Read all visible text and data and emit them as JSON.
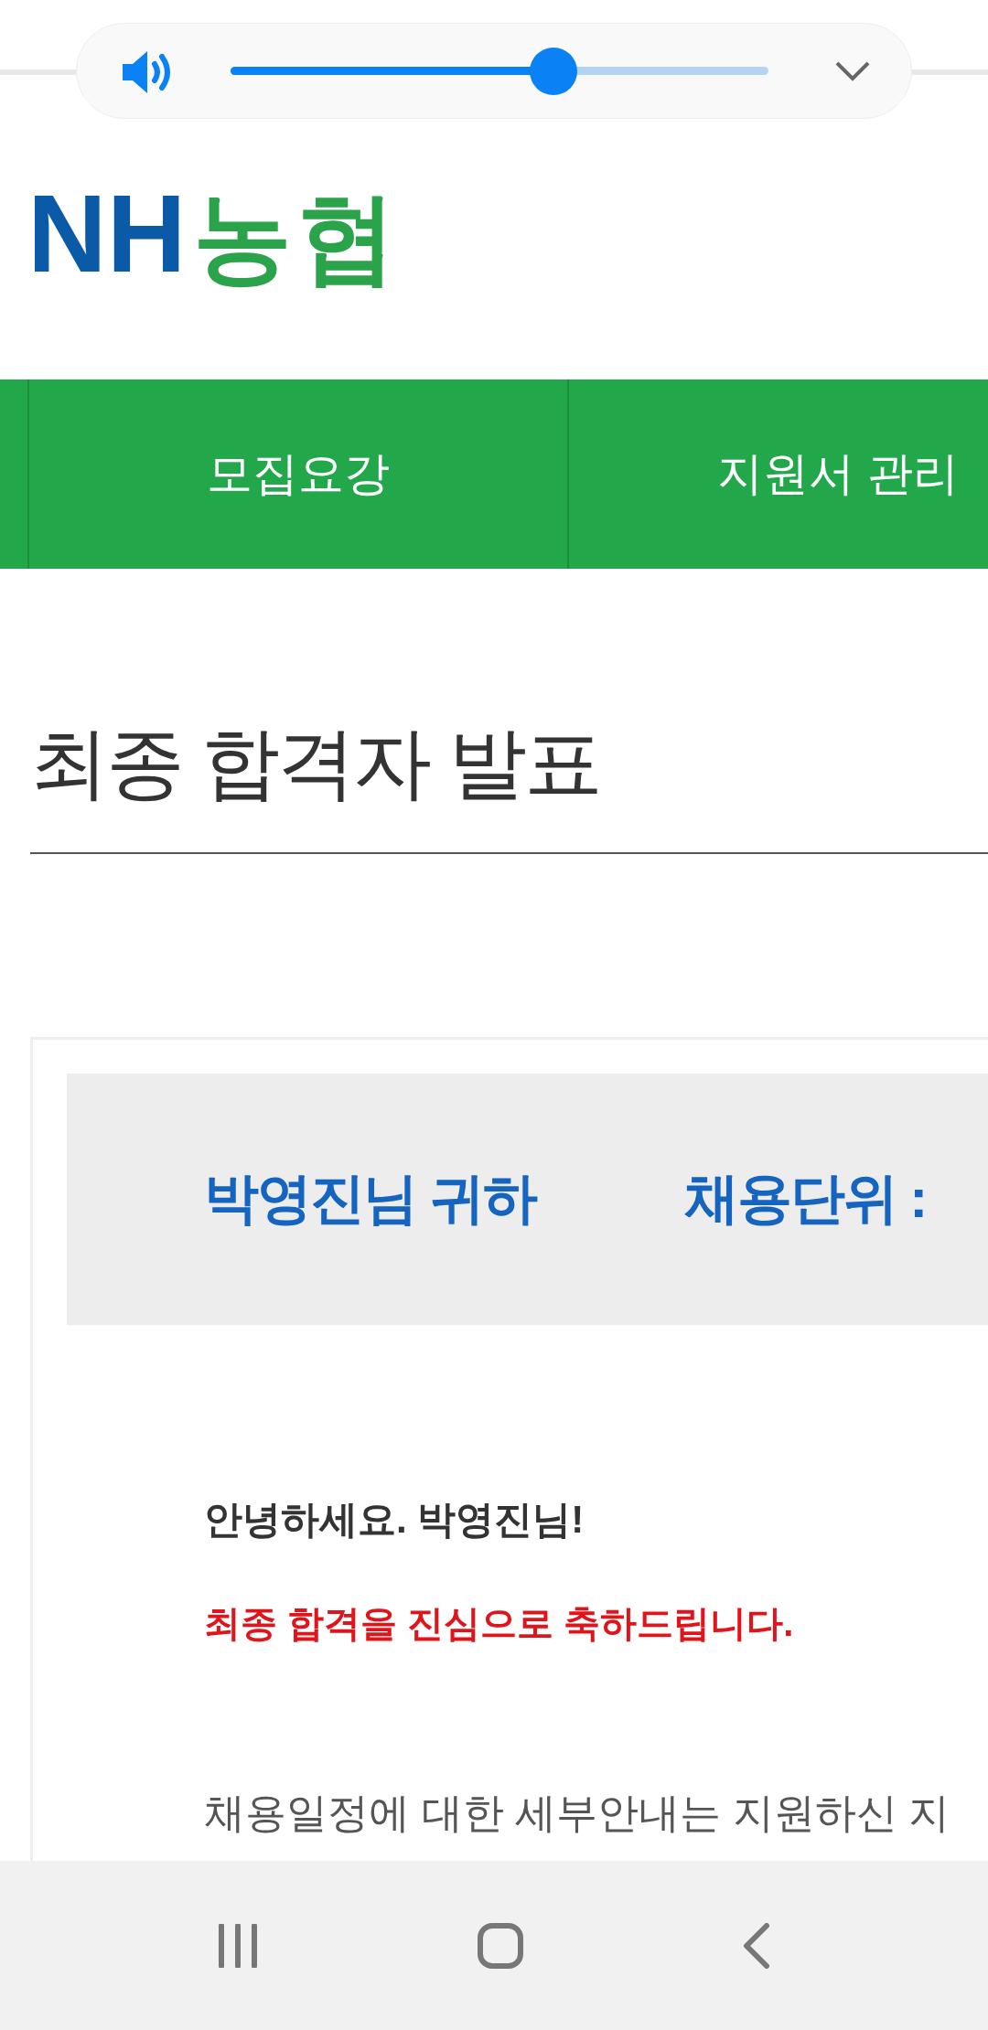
{
  "volume_panel": {
    "level": 0.6
  },
  "logo": {
    "latin": "NH",
    "korean": "농협"
  },
  "nav_tabs": [
    {
      "label": "모집요강"
    },
    {
      "label": "지원서 관리"
    }
  ],
  "page_title": "최종 합격자 발표",
  "result_card": {
    "recipient": "박영진님 귀하",
    "unit_label": "채용단위 :",
    "greeting": "안녕하세요. 박영진님!",
    "congratulation": "최종 합격을 진심으로 축하드립니다.",
    "body": "채용일정에 대한 세부안내는 지원하신 지"
  }
}
